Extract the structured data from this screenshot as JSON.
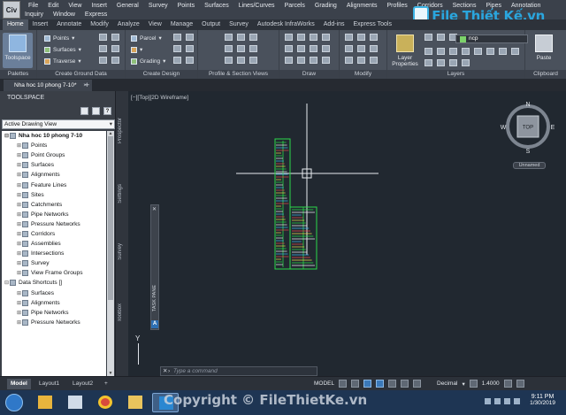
{
  "menu": {
    "app_button": "Civ",
    "row1": [
      "File",
      "Edit",
      "View",
      "Insert",
      "General",
      "Survey",
      "Points",
      "Surfaces",
      "Lines/Curves",
      "Parcels",
      "Grading",
      "Alignments",
      "Profiles",
      "Corridors",
      "Sections",
      "Pipes",
      "Annotation"
    ],
    "row2": [
      "Inquiry",
      "Window",
      "Express"
    ]
  },
  "logo": {
    "text": "File Thiết Kế.vn"
  },
  "ribbon_tabs": [
    "Home",
    "Insert",
    "Annotate",
    "Modify",
    "Analyze",
    "View",
    "Manage",
    "Output",
    "Survey",
    "Autodesk InfraWorks",
    "Add-ins",
    "Express Tools"
  ],
  "ribbon": {
    "toolspace": "Toolspace",
    "points": "Points",
    "surfaces": "Surfaces",
    "traverse": "Traverse",
    "parcel": "Parcel",
    "grading": "Grading",
    "layer_current": "ncp",
    "layer_properties": "Layer Properties",
    "paste": "Paste",
    "panels": [
      "Palettes",
      "Create Ground Data",
      "Create Design",
      "Profile & Section Views",
      "Draw",
      "Modify",
      "Layers",
      "Clipboard"
    ]
  },
  "file_tab": {
    "name": "Nha hoc 10 phong 7-10*",
    "close": "×",
    "new": "+"
  },
  "toolspace": {
    "title": "TOOLSPACE",
    "icons": [
      "?"
    ],
    "view_select": "Active Drawing View",
    "tree": [
      {
        "label": "Nha hoc 10 phong 7-10",
        "level": 0,
        "root": true
      },
      {
        "label": "Points",
        "level": 1
      },
      {
        "label": "Point Groups",
        "level": 1
      },
      {
        "label": "Surfaces",
        "level": 1
      },
      {
        "label": "Alignments",
        "level": 1
      },
      {
        "label": "Feature Lines",
        "level": 1
      },
      {
        "label": "Sites",
        "level": 1
      },
      {
        "label": "Catchments",
        "level": 1
      },
      {
        "label": "Pipe Networks",
        "level": 1
      },
      {
        "label": "Pressure Networks",
        "level": 1
      },
      {
        "label": "Corridors",
        "level": 1
      },
      {
        "label": "Assemblies",
        "level": 1
      },
      {
        "label": "Intersections",
        "level": 1
      },
      {
        "label": "Survey",
        "level": 1
      },
      {
        "label": "View Frame Groups",
        "level": 1
      },
      {
        "label": "Data Shortcuts []",
        "level": 0,
        "root": false
      },
      {
        "label": "Surfaces",
        "level": 1
      },
      {
        "label": "Alignments",
        "level": 1
      },
      {
        "label": "Pipe Networks",
        "level": 1
      },
      {
        "label": "Pressure Networks",
        "level": 1
      }
    ]
  },
  "side_tabs": [
    "Prospector",
    "Settings",
    "Survey",
    "Toolbox"
  ],
  "viewport": {
    "label": "[−][Top][2D Wireframe]",
    "task_pane": "TASK PANE",
    "ucs_y": "Y",
    "command_placeholder": "Type a command",
    "viewcube": {
      "top": "TOP",
      "n": "N",
      "s": "S",
      "e": "E",
      "w": "W"
    },
    "ucs_name": "Unnamed"
  },
  "layout_tabs": [
    "Model",
    "Layout1",
    "Layout2"
  ],
  "status": {
    "model": "MODEL",
    "units": "Decimal",
    "scale": "1.4000"
  },
  "taskbar": {
    "watermark": "Copyright © FileThietKe.vn",
    "time": "9:11 PM",
    "date": "1/30/2019"
  }
}
